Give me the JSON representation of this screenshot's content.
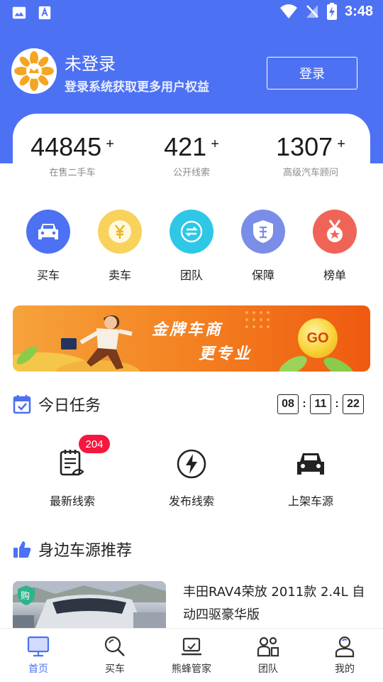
{
  "status_bar": {
    "time": "3:48"
  },
  "user": {
    "name": "未登录",
    "subtitle": "登录系统获取更多用户权益",
    "login_label": "登录"
  },
  "stats": [
    {
      "value": "44845",
      "suffix": "+",
      "label": "在售二手车"
    },
    {
      "value": "421",
      "suffix": "+",
      "label": "公开线索"
    },
    {
      "value": "1307",
      "suffix": "+",
      "label": "高级汽车顾问"
    }
  ],
  "quick_nav": [
    {
      "label": "买车",
      "icon": "car-icon",
      "color": "#4d71f3"
    },
    {
      "label": "卖车",
      "icon": "yen-coin-icon",
      "color": "#f7cf49"
    },
    {
      "label": "团队",
      "icon": "team-icon",
      "color": "#2fc7e6"
    },
    {
      "label": "保障",
      "icon": "shield-icon",
      "color": "#7a8ee8"
    },
    {
      "label": "榜单",
      "icon": "medal-icon",
      "color": "#f06458"
    }
  ],
  "banner": {
    "line1": "金牌车商",
    "line2": "更专业",
    "go": "GO"
  },
  "tasks": {
    "title": "今日任务",
    "countdown": {
      "hours": "08",
      "minutes": "11",
      "seconds": "22",
      "sep": ":"
    },
    "items": [
      {
        "label": "最新线索",
        "icon": "clipboard-icon",
        "badge": "204"
      },
      {
        "label": "发布线索",
        "icon": "lightning-icon"
      },
      {
        "label": "上架车源",
        "icon": "car-front-icon"
      }
    ]
  },
  "recommend": {
    "title": "身边车源推荐",
    "car": {
      "badge": "购",
      "title": "丰田RAV4荣放 2011款 2.4L 自动四驱豪华版"
    }
  },
  "bottom_nav": [
    {
      "label": "首页",
      "icon": "monitor-icon",
      "active": true
    },
    {
      "label": "买车",
      "icon": "search-icon",
      "active": false
    },
    {
      "label": "熊蜂管家",
      "icon": "laptop-icon",
      "active": false
    },
    {
      "label": "团队",
      "icon": "people-icon",
      "active": false
    },
    {
      "label": "我的",
      "icon": "profile-icon",
      "active": false
    }
  ],
  "colors": {
    "primary": "#4d71f3",
    "badge": "#f5173d"
  }
}
